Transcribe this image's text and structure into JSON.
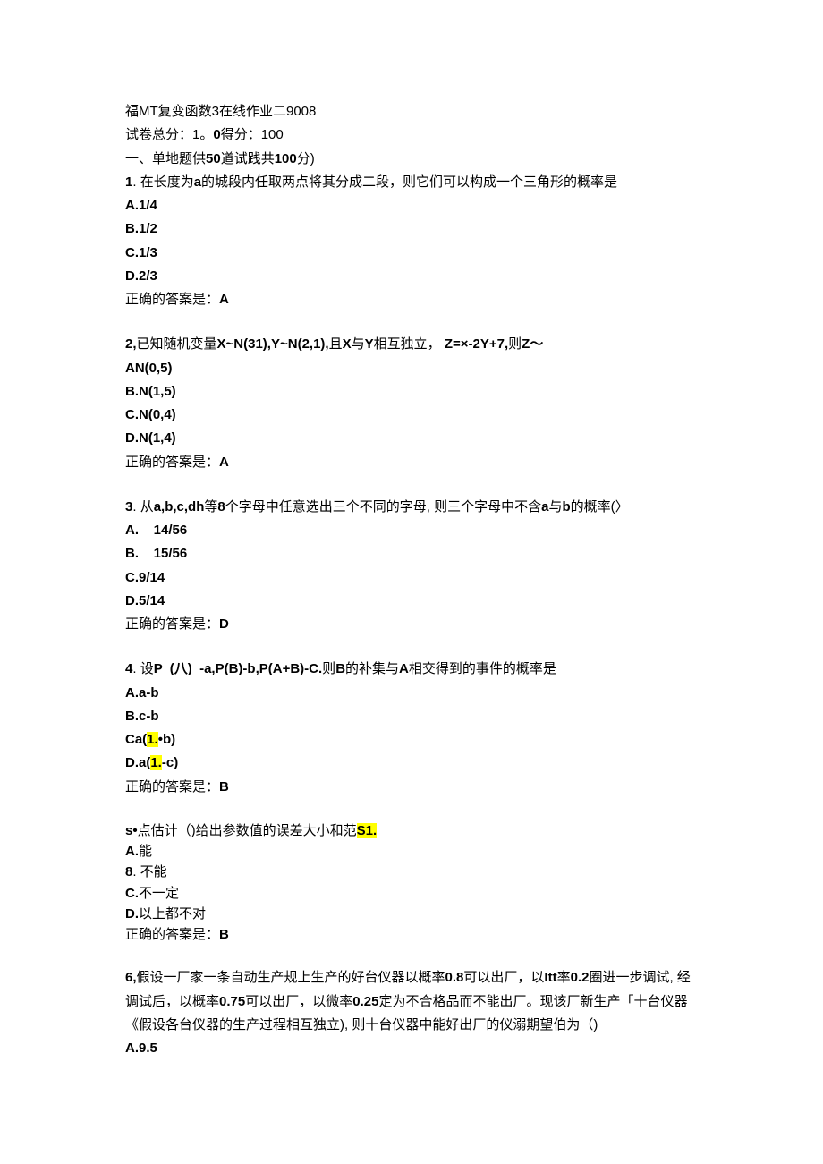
{
  "header": {
    "title": "福MT复变函数3在线作业二9008",
    "score_line_a": "试卷总分：1。",
    "score_line_b": "0",
    "score_line_c": "得分：100",
    "section_a": "一、单地题供",
    "section_b": "50",
    "section_c": "道试践共",
    "section_d": "100",
    "section_e": "分)"
  },
  "q1": {
    "num": "1",
    "dot": ". ",
    "stem_a": "在长度为",
    "stem_b": "a",
    "stem_c": "的城段内任取两点将其分成二段，则它们可以构成一个三角形的概率是",
    "optA": "A.1/4",
    "optB": "B.1/2",
    "optC": "C.1/3",
    "optD": "D.2/3",
    "ans_label": "正确的答案是：",
    "ans": "A"
  },
  "q2": {
    "num": "2,",
    "stem_a": "已知随机变量",
    "stem_b": "X~N(31),Y~N(2,1),",
    "stem_c": "且",
    "stem_d": "X",
    "stem_e": "与",
    "stem_f": "Y",
    "stem_g": "相互独立， ",
    "stem_h": "Z=×-2Y+7,",
    "stem_i": "则",
    "stem_j": "Z〜",
    "optA": "AN(0,5)",
    "optB": "B.N(1,5)",
    "optC": "C.N(0,4)",
    "optD": "D.N(1,4)",
    "ans_label": "正确的答案是：",
    "ans": "A"
  },
  "q3": {
    "num": "3",
    "dot": ". ",
    "stem_a": "从",
    "stem_b": "a,b,c,dh",
    "stem_c": "等",
    "stem_d": "8",
    "stem_e": "个字母中任意选出三个不同的字母, 则三个字母中不含",
    "stem_f": "a",
    "stem_g": "与",
    "stem_h": "b",
    "stem_i": "的概率(〉",
    "optA": "A.    14/56",
    "optB": "B.    15/56",
    "optC": "C.9/14",
    "optD": "D.5/14",
    "ans_label": "正确的答案是：",
    "ans": "D"
  },
  "q4": {
    "num": "4",
    "dot": ". ",
    "stem_a": "设",
    "stem_b": "P  (八)  -a,P(B)-b,P(A+B)-C.",
    "stem_c": "则",
    "stem_d": "B",
    "stem_e": "的补集与",
    "stem_f": "A",
    "stem_g": "相交得到的事件的概率是",
    "optA": "A.a-b",
    "optB": "B.c-b",
    "optC_a": "Ca(",
    "optC_hl": "1.",
    "optC_b": "•b)",
    "optD_a": "D.a(",
    "optD_hl": "1.",
    "optD_b": "-c)",
    "ans_label": "正确的答案是：",
    "ans": "B"
  },
  "q5": {
    "stem_a": "s•",
    "stem_b": "点估计（)给出参数值的误差大小和范",
    "stem_c": "S1.",
    "optA_a": "A.",
    "optA_b": "能",
    "optB_a": "8",
    "optB_b": ". 不能",
    "optC_a": "C.",
    "optC_b": "不一定",
    "optD_a": "D.",
    "optD_b": "以上都不对",
    "ans_label": "正确的答案是：",
    "ans": "B"
  },
  "q6": {
    "num": "6,",
    "l1_a": "假设一厂家一条自动生产规上生产的好台仪器以概率",
    "l1_b": "0.8",
    "l1_c": "可以出厂，以",
    "l1_d": "Itt",
    "l1_e": "率",
    "l1_f": "0.2",
    "l1_g": "圈进一步调试, 经",
    "l2_a": "调试后，以概率",
    "l2_b": "0.75",
    "l2_c": "可以出厂，以微率",
    "l2_d": "0.25",
    "l2_e": "定为不合格品而不能出厂。现该厂新生产「十台仪器",
    "l3": "《假设各台仪器的生产过程相互独立), 则十台仪器中能好出厂的仪溺期望伯为（)",
    "optA": "A.9.5"
  }
}
